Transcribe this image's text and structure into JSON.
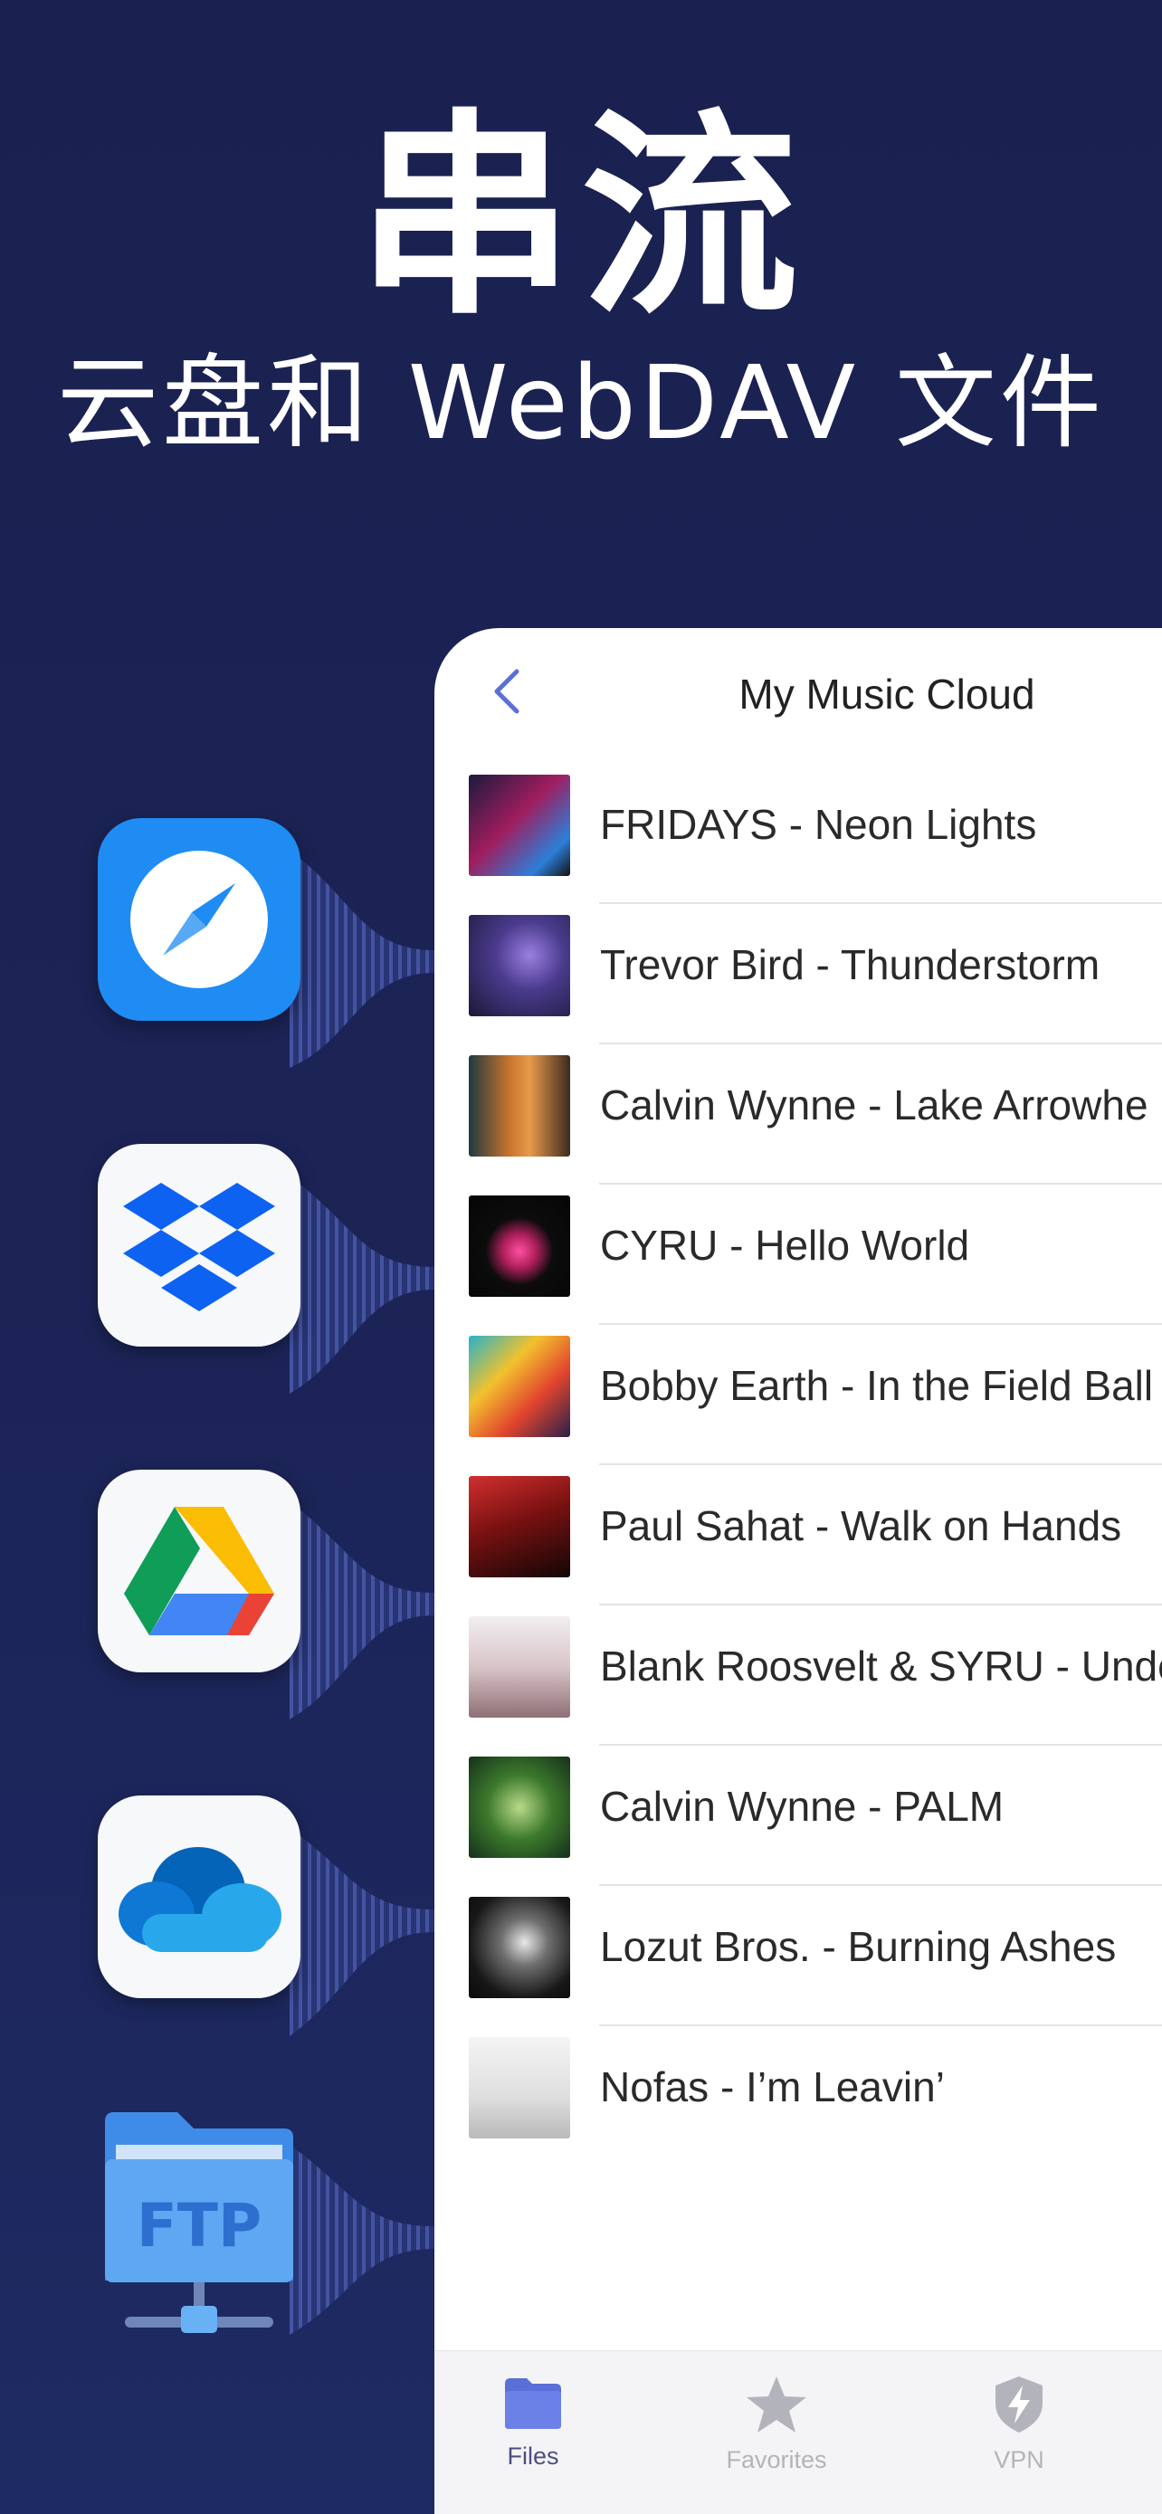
{
  "hero": {
    "title": "串流",
    "subtitle": "云盘和 WebDAV 文件"
  },
  "services": [
    {
      "name": "safari-icon"
    },
    {
      "name": "dropbox-icon"
    },
    {
      "name": "google-drive-icon"
    },
    {
      "name": "onedrive-icon"
    },
    {
      "name": "ftp-server-icon",
      "label": "FTP"
    }
  ],
  "panel": {
    "title": "My Music Cloud",
    "back_icon": "chevron-left-icon",
    "tracks": [
      {
        "title": "FRIDAYS - Neon Lights"
      },
      {
        "title": "Trevor Bird - Thunderstorm"
      },
      {
        "title": "Calvin Wynne - Lake Arrowhe"
      },
      {
        "title": "CYRU - Hello World"
      },
      {
        "title": "Bobby Earth - In the Field Ball"
      },
      {
        "title": "Paul Sahat - Walk on Hands"
      },
      {
        "title": "Blank Roosvelt & SYRU - Unde"
      },
      {
        "title": "Calvin Wynne - PALM"
      },
      {
        "title": "Lozut Bros. - Burning Ashes"
      },
      {
        "title": "Nofas - I’m Leavin’"
      }
    ],
    "tabs": [
      {
        "label": "Files",
        "icon": "folder-icon"
      },
      {
        "label": "Favorites",
        "icon": "star-icon"
      },
      {
        "label": "VPN",
        "icon": "shield-bolt-icon"
      }
    ]
  },
  "colors": {
    "background": "#1c2457",
    "accent": "#5b6fd8",
    "safari_blue": "#1f8cf3",
    "tab_active": "#4a4f7e",
    "tab_inactive": "#b3b3bb"
  }
}
